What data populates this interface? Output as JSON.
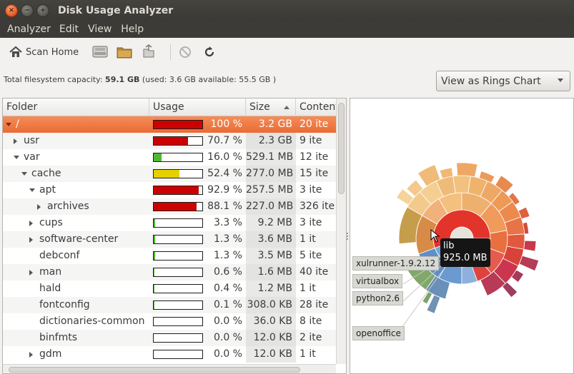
{
  "window": {
    "title": "Disk Usage Analyzer",
    "buttons": {
      "close": "×",
      "minimize": "−",
      "maximize": "+"
    }
  },
  "menu": [
    "Analyzer",
    "Edit",
    "View",
    "Help"
  ],
  "toolbar": {
    "scan_home_label": "Scan Home",
    "icons": [
      "home-icon",
      "drive-icon",
      "folder-icon",
      "network-folder-icon",
      "stop-icon",
      "refresh-icon"
    ]
  },
  "capacity": {
    "prefix": "Total filesystem capacity: ",
    "total": "59.1 GB",
    "detail": " (used: 3.6 GB available: 55.5 GB )"
  },
  "view_combo": {
    "value": "View as Rings Chart"
  },
  "columns": {
    "folder": "Folder",
    "usage": "Usage",
    "size": "Size",
    "contents": "Contents"
  },
  "colors": {
    "selection": "#ef7a46",
    "bar_red": "#cc0000",
    "bar_green": "#4fb830",
    "bar_yellow": "#e5d000"
  },
  "rows": [
    {
      "name": "/",
      "depth": 0,
      "expander": "open",
      "usage_pct": "100 %",
      "usage": 1.0,
      "bar": "red",
      "size": "3.2 GB",
      "contents": "20 ite",
      "selected": true
    },
    {
      "name": "usr",
      "depth": 1,
      "expander": "closed",
      "usage_pct": "70.7 %",
      "usage": 0.707,
      "bar": "red",
      "size": "2.3 GB",
      "contents": "9 ite"
    },
    {
      "name": "var",
      "depth": 1,
      "expander": "open",
      "usage_pct": "16.0 %",
      "usage": 0.16,
      "bar": "green",
      "size": "529.1 MB",
      "contents": "12 ite"
    },
    {
      "name": "cache",
      "depth": 2,
      "expander": "open",
      "usage_pct": "52.4 %",
      "usage": 0.524,
      "bar": "yellow",
      "size": "277.0 MB",
      "contents": "15 ite"
    },
    {
      "name": "apt",
      "depth": 3,
      "expander": "open",
      "usage_pct": "92.9 %",
      "usage": 0.929,
      "bar": "red",
      "size": "257.5 MB",
      "contents": "3 ite"
    },
    {
      "name": "archives",
      "depth": 4,
      "expander": "closed",
      "usage_pct": "88.1 %",
      "usage": 0.881,
      "bar": "red",
      "size": "227.0 MB",
      "contents": "326 ite"
    },
    {
      "name": "cups",
      "depth": 3,
      "expander": "closed",
      "usage_pct": "3.3 %",
      "usage": 0.033,
      "bar": "green",
      "size": "9.2 MB",
      "contents": "3 ite"
    },
    {
      "name": "software-center",
      "depth": 3,
      "expander": "closed",
      "usage_pct": "1.3 %",
      "usage": 0.013,
      "bar": "green",
      "size": "3.6 MB",
      "contents": "1 it"
    },
    {
      "name": "debconf",
      "depth": 3,
      "expander": "none",
      "usage_pct": "1.3 %",
      "usage": 0.013,
      "bar": "green",
      "size": "3.5 MB",
      "contents": "5 ite"
    },
    {
      "name": "man",
      "depth": 3,
      "expander": "closed",
      "usage_pct": "0.6 %",
      "usage": 0.006,
      "bar": "green",
      "size": "1.6 MB",
      "contents": "40 ite"
    },
    {
      "name": "hald",
      "depth": 3,
      "expander": "none",
      "usage_pct": "0.4 %",
      "usage": 0.004,
      "bar": "green",
      "size": "1.2 MB",
      "contents": "1 it"
    },
    {
      "name": "fontconfig",
      "depth": 3,
      "expander": "none",
      "usage_pct": "0.1 %",
      "usage": 0.001,
      "bar": "green",
      "size": "308.0 KB",
      "contents": "28 ite"
    },
    {
      "name": "dictionaries-common",
      "depth": 3,
      "expander": "none",
      "usage_pct": "0.0 %",
      "usage": 0.0,
      "bar": "green",
      "size": "36.0 KB",
      "contents": "8 ite"
    },
    {
      "name": "binfmts",
      "depth": 3,
      "expander": "none",
      "usage_pct": "0.0 %",
      "usage": 0.0,
      "bar": "green",
      "size": "12.0 KB",
      "contents": "2 ite"
    },
    {
      "name": "gdm",
      "depth": 3,
      "expander": "closed",
      "usage_pct": "0.0 %",
      "usage": 0.0,
      "bar": "green",
      "size": "12.0 KB",
      "contents": "1 it"
    }
  ],
  "chart": {
    "tooltip": {
      "name": "lib",
      "size": "925.0 MB"
    },
    "labels": [
      "xulrunner-1.9.2.12",
      "virtualbox",
      "python2.6",
      "openoffice"
    ]
  }
}
